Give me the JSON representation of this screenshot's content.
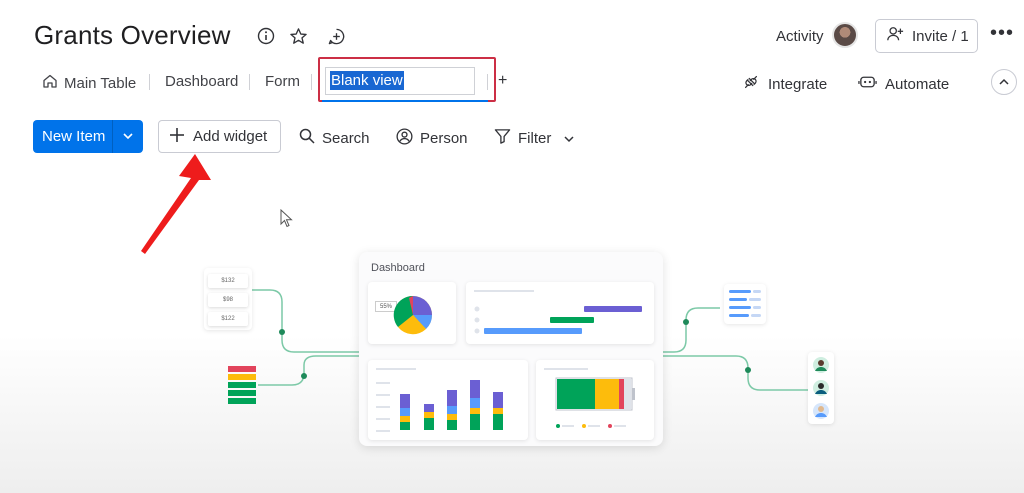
{
  "header": {
    "title": "Grants Overview",
    "activity_label": "Activity",
    "invite_label": "Invite / 1"
  },
  "tabs": {
    "main_table": "Main Table",
    "dashboard": "Dashboard",
    "form": "Form",
    "editing_value": "Blank view",
    "add": "+"
  },
  "actions": {
    "integrate": "Integrate",
    "automate": "Automate"
  },
  "toolbar": {
    "new_item": "New Item",
    "add_widget": "Add widget",
    "search": "Search",
    "person": "Person",
    "filter": "Filter"
  },
  "illustration": {
    "dashboard_title": "Dashboard",
    "values": [
      "$132",
      "$98",
      "$122"
    ],
    "pie_label": "55%"
  },
  "colors": {
    "primary": "#0073ea",
    "highlight": "#cc2f45",
    "arrow": "#ee1c1c",
    "connector": "#7cc9a7",
    "green": "#00a359",
    "yellow": "#fdbc0c",
    "blue": "#579bfc",
    "purple": "#6b5fd3",
    "red": "#e2445c"
  }
}
